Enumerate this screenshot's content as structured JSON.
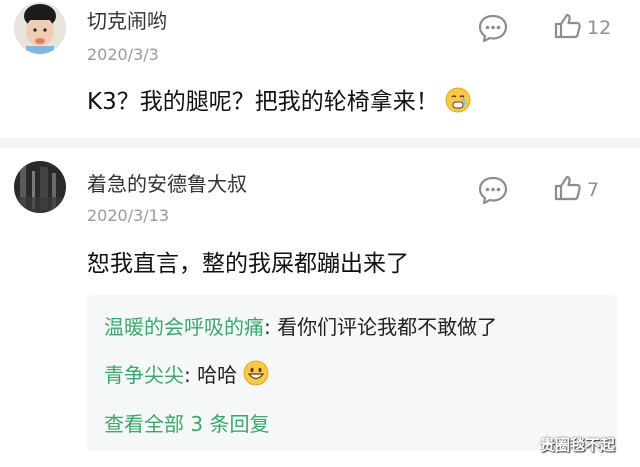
{
  "comments": [
    {
      "username": "切克闹哟",
      "date": "2020/3/3",
      "text": "K3？我的腿呢？把我的轮椅拿来！",
      "emoji": "crying-face-emoji",
      "likes": "12"
    },
    {
      "username": "着急的安德鲁大叔",
      "date": "2020/3/13",
      "text": "恕我直言，整的我屎都蹦出来了",
      "likes": "7",
      "replies": [
        {
          "author": "温暖的会呼吸的痛",
          "separator": ": ",
          "text": "看你们评论我都不敢做了"
        },
        {
          "author": "青争尖尖",
          "separator": ": ",
          "text": "哈哈",
          "emoji": "grinning-face-emoji"
        }
      ],
      "view_all": "查看全部 3 条回复"
    }
  ],
  "watermark": "贵圈毯不起",
  "colors": {
    "accent_green": "#3aa86a",
    "reply_bg": "#f6f7f9",
    "icon_gray": "#8d8d8d"
  }
}
